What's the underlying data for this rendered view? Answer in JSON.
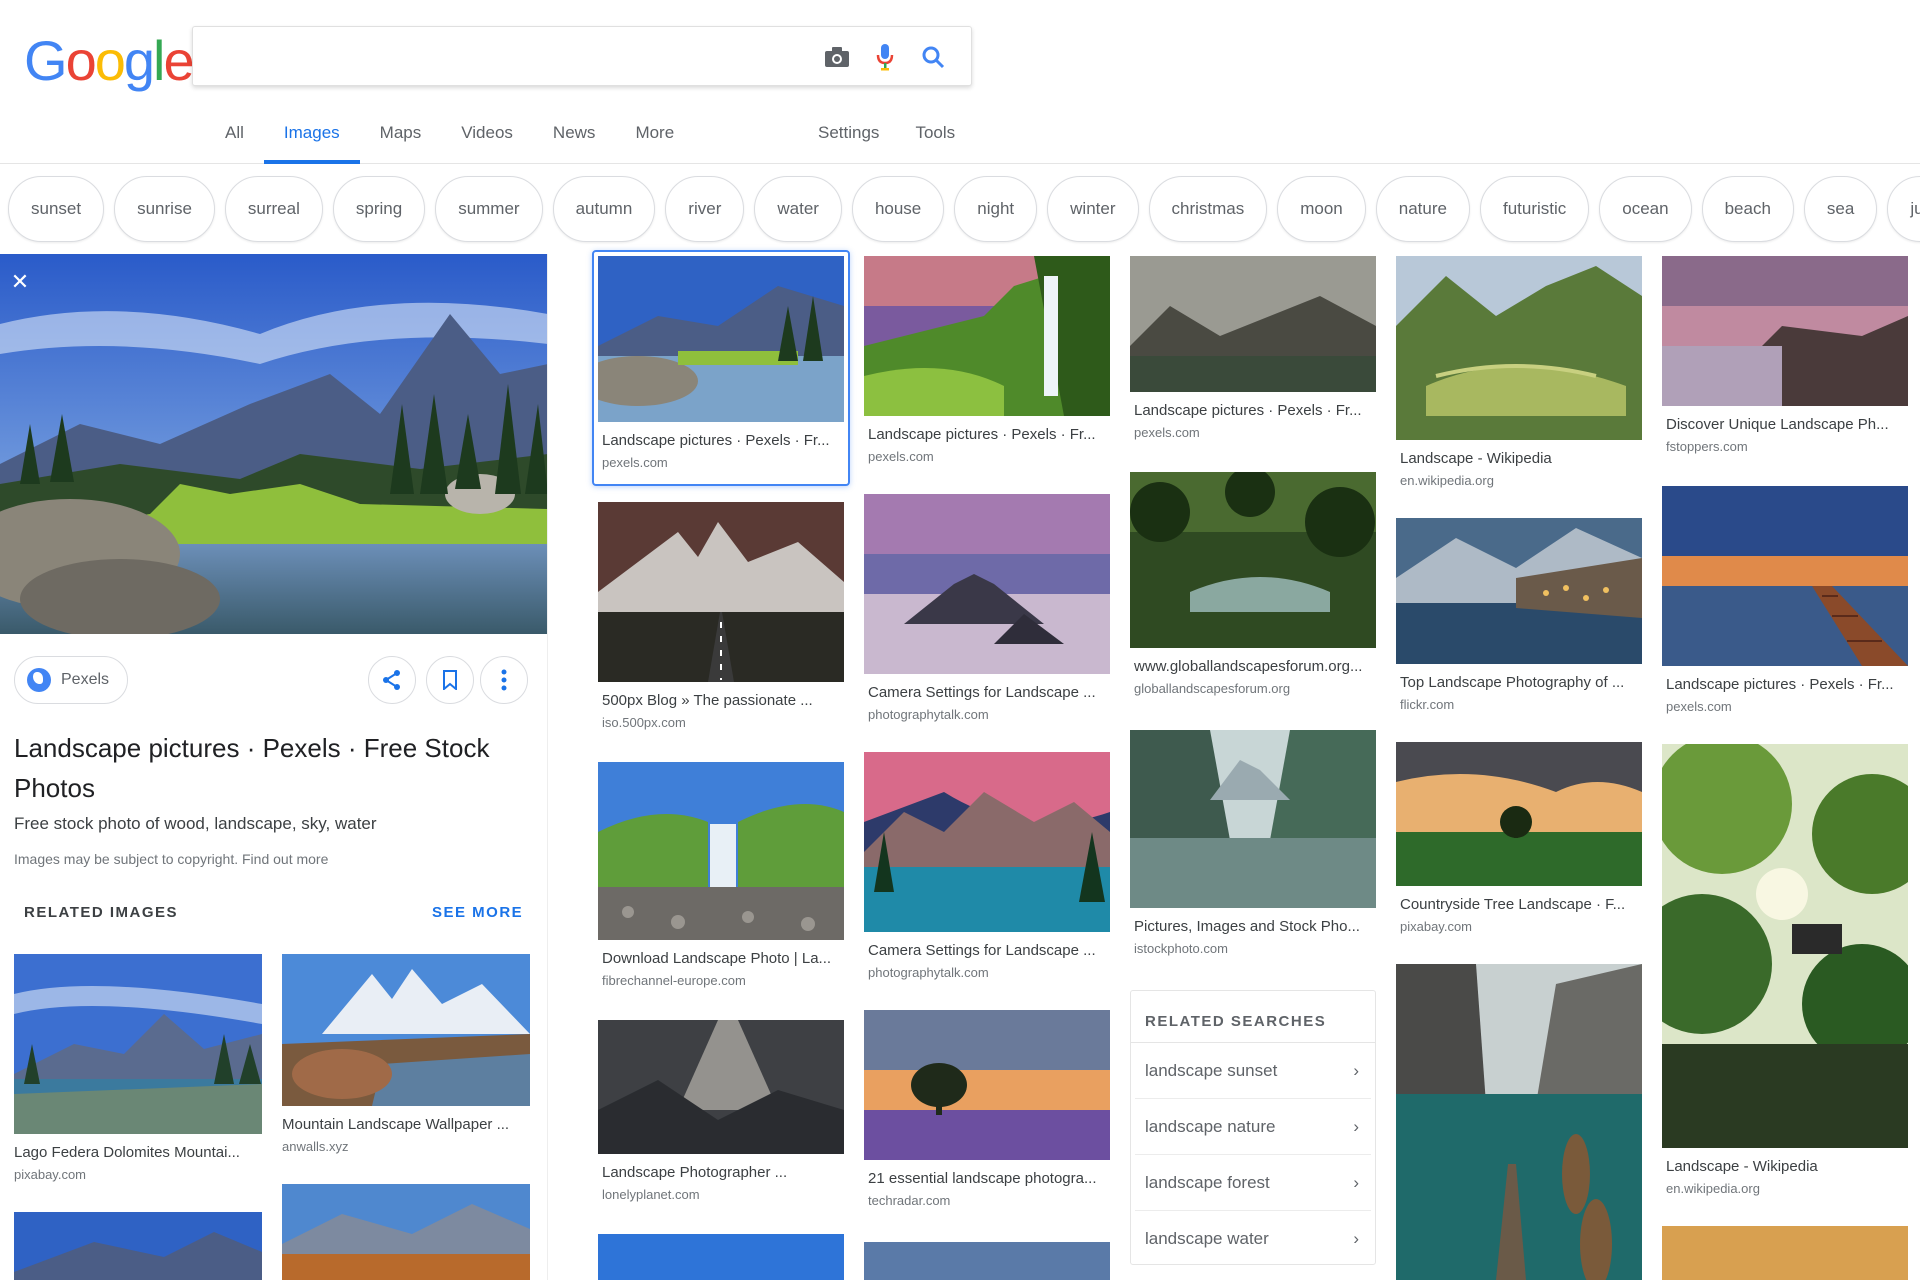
{
  "logo": {
    "letters": [
      "G",
      "o",
      "o",
      "g",
      "l",
      "e"
    ]
  },
  "search": {
    "value": "",
    "placeholder": ""
  },
  "tabs": [
    {
      "label": "All"
    },
    {
      "label": "Images"
    },
    {
      "label": "Maps"
    },
    {
      "label": "Videos"
    },
    {
      "label": "News"
    },
    {
      "label": "More"
    }
  ],
  "tools": {
    "settings": "Settings",
    "tools": "Tools"
  },
  "chips": [
    "sunset",
    "sunrise",
    "surreal",
    "spring",
    "summer",
    "autumn",
    "river",
    "water",
    "house",
    "night",
    "winter",
    "christmas",
    "moon",
    "nature",
    "futuristic",
    "ocean",
    "beach",
    "sea",
    "jungle"
  ],
  "panel": {
    "source": "Pexels",
    "title": "Landscape pictures · Pexels · Free Stock Photos",
    "description": "Free stock photo of wood, landscape, sky, water",
    "copyright_prefix": "Images may be subject to copyright. ",
    "copyright_link": "Find out more",
    "related_heading": "RELATED IMAGES",
    "see_more": "SEE MORE",
    "related": [
      {
        "title": "Lago Federa Dolomites Mountai...",
        "site": "pixabay.com"
      },
      {
        "title": "Mountain Landscape Wallpaper ...",
        "site": "anwalls.xyz"
      },
      {
        "title": "",
        "site": ""
      },
      {
        "title": "",
        "site": ""
      }
    ]
  },
  "grid": {
    "col1": [
      {
        "title": "Landscape pictures · Pexels · Fr...",
        "site": "pexels.com"
      },
      {
        "title": "500px Blog » The passionate ...",
        "site": "iso.500px.com"
      },
      {
        "title": "Download Landscape Photo | La...",
        "site": "fibrechannel-europe.com"
      },
      {
        "title": "Landscape Photographer ...",
        "site": "lonelyplanet.com"
      }
    ],
    "col2": [
      {
        "title": "Landscape pictures · Pexels · Fr...",
        "site": "pexels.com"
      },
      {
        "title": "Camera Settings for Landscape ...",
        "site": "photographytalk.com"
      },
      {
        "title": "Camera Settings for Landscape ...",
        "site": "photographytalk.com"
      },
      {
        "title": "21 essential landscape photogra...",
        "site": "techradar.com"
      }
    ],
    "col3": [
      {
        "title": "Landscape pictures · Pexels · Fr...",
        "site": "pexels.com"
      },
      {
        "title": "www.globallandscapesforum.org...",
        "site": "globallandscapesforum.org"
      },
      {
        "title": "Pictures, Images and Stock Pho...",
        "site": "istockphoto.com"
      }
    ],
    "col4": [
      {
        "title": "Landscape - Wikipedia",
        "site": "en.wikipedia.org"
      },
      {
        "title": "Top Landscape Photography of ...",
        "site": "flickr.com"
      },
      {
        "title": "Countryside Tree Landscape · F...",
        "site": "pixabay.com"
      }
    ],
    "col5": [
      {
        "title": "Discover Unique Landscape Ph...",
        "site": "fstoppers.com"
      },
      {
        "title": "Landscape pictures · Pexels · Fr...",
        "site": "pexels.com"
      },
      {
        "title": "Landscape - Wikipedia",
        "site": "en.wikipedia.org"
      }
    ]
  },
  "related_searches": {
    "heading": "RELATED SEARCHES",
    "items": [
      "landscape sunset",
      "landscape nature",
      "landscape forest",
      "landscape water"
    ]
  },
  "colors": {
    "accent": "#1a73e8",
    "blue": "#4285f4",
    "red": "#ea4335",
    "yellow": "#fbbc05",
    "green": "#34a853"
  }
}
